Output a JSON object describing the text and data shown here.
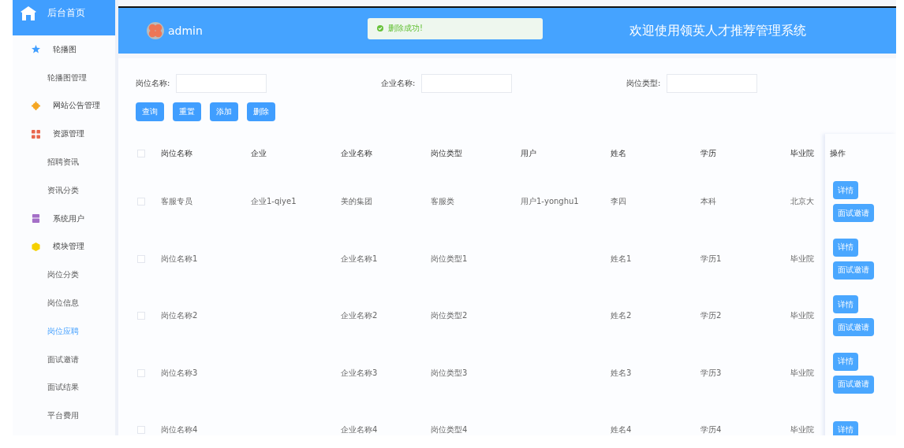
{
  "sidebar": {
    "home": "后台首页",
    "items": [
      {
        "kind": "group",
        "label": "轮播图",
        "selected": false
      },
      {
        "kind": "sub",
        "label": "轮播图管理",
        "selected": false
      },
      {
        "kind": "group",
        "label": "网站公告管理",
        "selected": false
      },
      {
        "kind": "group",
        "label": "资源管理",
        "selected": false
      },
      {
        "kind": "sub",
        "label": "招聘资讯",
        "selected": false
      },
      {
        "kind": "sub",
        "label": "资讯分类",
        "selected": false
      },
      {
        "kind": "group",
        "label": "系统用户",
        "selected": false
      },
      {
        "kind": "group",
        "label": "模块管理",
        "selected": false
      },
      {
        "kind": "sub",
        "label": "岗位分类",
        "selected": false
      },
      {
        "kind": "sub",
        "label": "岗位信息",
        "selected": false
      },
      {
        "kind": "sub",
        "label": "岗位应聘",
        "selected": true
      },
      {
        "kind": "sub",
        "label": "面试邀请",
        "selected": false
      },
      {
        "kind": "sub",
        "label": "面试结果",
        "selected": false
      },
      {
        "kind": "sub",
        "label": "平台费用",
        "selected": false
      }
    ]
  },
  "header": {
    "user": "admin",
    "toast": "删除成功!",
    "title": "欢迎使用领英人才推荐管理系统"
  },
  "filters": [
    {
      "label": "岗位名称:"
    },
    {
      "label": "企业名称:"
    },
    {
      "label": "岗位类型:"
    }
  ],
  "buttons": [
    "查询",
    "重置",
    "添加",
    "删除"
  ],
  "table": {
    "all_checked": false,
    "columns": [
      "岗位名称",
      "企业",
      "企业名称",
      "岗位类型",
      "用户",
      "姓名",
      "学历",
      "毕业院"
    ],
    "action_column": "操作",
    "rows": [
      {
        "checked": false,
        "cells": [
          "客服专员",
          "企业1-qiye1",
          "美的集团",
          "客服类",
          "用户1-yonghu1",
          "李四",
          "本科",
          "北京大"
        ],
        "actions": [
          "详情",
          "面试邀请"
        ]
      },
      {
        "checked": false,
        "cells": [
          "岗位名称1",
          "",
          "企业名称1",
          "岗位类型1",
          "",
          "姓名1",
          "学历1",
          "毕业院"
        ],
        "actions": [
          "详情",
          "面试邀请"
        ]
      },
      {
        "checked": false,
        "cells": [
          "岗位名称2",
          "",
          "企业名称2",
          "岗位类型2",
          "",
          "姓名2",
          "学历2",
          "毕业院"
        ],
        "actions": [
          "详情",
          "面试邀请"
        ]
      },
      {
        "checked": false,
        "cells": [
          "岗位名称3",
          "",
          "企业名称3",
          "岗位类型3",
          "",
          "姓名3",
          "学历3",
          "毕业院"
        ],
        "actions": [
          "详情",
          "面试邀请"
        ]
      },
      {
        "checked": false,
        "cells": [
          "岗位名称4",
          "",
          "企业名称4",
          "岗位类型4",
          "",
          "姓名4",
          "学历4",
          "毕业院"
        ],
        "actions": [
          "详情"
        ]
      }
    ]
  }
}
